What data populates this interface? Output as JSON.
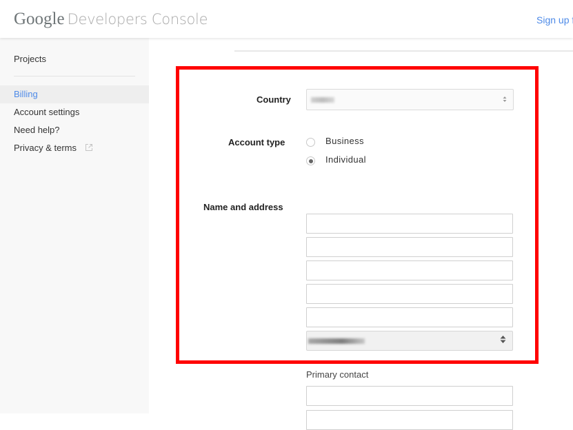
{
  "header": {
    "logo_brand": "Google",
    "logo_product": "Developers Console",
    "signup_link": "Sign up f"
  },
  "sidebar": {
    "items": [
      {
        "label": "Projects",
        "active": false
      },
      {
        "label": "Billing",
        "active": true
      },
      {
        "label": "Account settings",
        "active": false
      },
      {
        "label": "Need help?",
        "active": false
      },
      {
        "label": "Privacy & terms",
        "active": false,
        "icon": "external-link-icon"
      }
    ]
  },
  "form": {
    "country": {
      "label": "Country",
      "value": ""
    },
    "account_type": {
      "label": "Account type",
      "options": [
        {
          "label": "Business",
          "checked": false
        },
        {
          "label": "Individual",
          "checked": true
        }
      ]
    },
    "name_address": {
      "label": "Name and address",
      "fields": [
        "",
        "",
        "",
        "",
        ""
      ],
      "region_select_value": ""
    },
    "primary_contact": {
      "label": "Primary contact",
      "fields": [
        ""
      ]
    }
  },
  "colors": {
    "accent": "#4d8ae8",
    "highlight": "#ff0000",
    "sidebar_bg": "#f8f8f8",
    "active_bg": "#eeeeee"
  }
}
